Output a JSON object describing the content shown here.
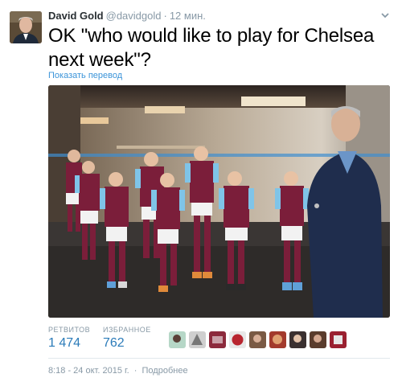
{
  "author": {
    "name": "David Gold",
    "handle": "@davidgold",
    "separator": "·",
    "time_ago": "12 мин."
  },
  "tweet": {
    "text": "OK \"who would like to play for Chelsea next week\"?",
    "translate_link": "Показать перевод"
  },
  "stats": {
    "retweets_label": "РЕТВИТОВ",
    "retweets_value": "1 474",
    "likes_label": "ИЗБРАННОЕ",
    "likes_value": "762"
  },
  "liker_avatars": [
    "avatar-1",
    "avatar-2",
    "avatar-3",
    "avatar-4",
    "avatar-5",
    "avatar-6",
    "avatar-7",
    "avatar-8",
    "avatar-9"
  ],
  "footer": {
    "timestamp": "8:18 - 24 окт. 2015 г.",
    "separator": "·",
    "details_link": "Подробнее"
  },
  "colors": {
    "link": "#3b94d9",
    "stat_value": "#2b7bb9",
    "muted": "#8899a6",
    "claret": "#7b1e3a",
    "sky_blue": "#7fc4e8"
  },
  "icons": {
    "menu": "chevron-down-icon"
  }
}
